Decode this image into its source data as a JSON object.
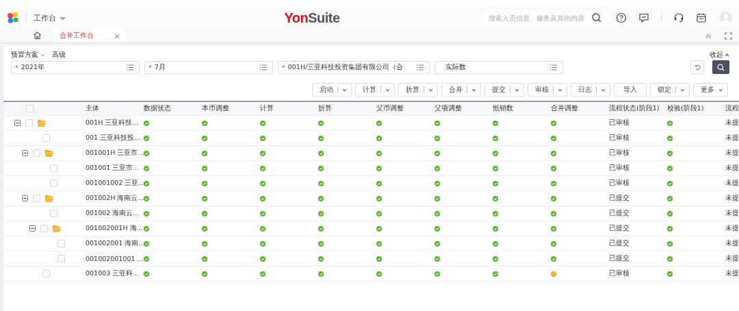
{
  "header": {
    "app_menu": "工作台",
    "logo": [
      "Yon",
      "Suite"
    ],
    "search": {
      "placeholder": "搜索人员信息、服务及其他内容"
    }
  },
  "tabs": [
    {
      "label": "合并工作台",
      "selected": true
    }
  ],
  "filter": {
    "scheme": "预置方案",
    "advanced": "高级",
    "collapse": "收起",
    "fields": [
      {
        "value": "2021年",
        "marker": "*"
      },
      {
        "value": "7月",
        "marker": "*"
      },
      {
        "value": "001H/三亚科技投资集团有限公司（合",
        "marker": "*"
      },
      {
        "value": "实际数"
      }
    ]
  },
  "toolbar": [
    {
      "label": "启动",
      "kind": "split"
    },
    {
      "label": "计算",
      "kind": "split"
    },
    {
      "label": "折算",
      "kind": "split"
    },
    {
      "label": "合并",
      "kind": "split"
    },
    {
      "label": "提交",
      "kind": "split"
    },
    {
      "label": "审核",
      "kind": "split"
    },
    {
      "label": "日志",
      "kind": "split"
    },
    {
      "label": "导入",
      "kind": "plain"
    },
    {
      "label": "锁定",
      "kind": "split"
    },
    {
      "label": "更多",
      "kind": "dropdown"
    }
  ],
  "table": {
    "header_checked": false,
    "columns": [
      "主体",
      "数据状态",
      "本币调整",
      "计算",
      "折算",
      "父币调整",
      "父项调整",
      "抵销数",
      "合并调整",
      "流程状态(阶段1)",
      "校验(阶段1)",
      "流程"
    ],
    "rows": [
      {
        "entity": "001H 三亚科技...",
        "checked": false,
        "expanded": true,
        "statuses": [
          {
            "warning": false
          },
          {
            "warning": false
          },
          {
            "warning": false
          },
          {
            "warning": false
          },
          {
            "warning": false
          },
          {
            "warning": false
          },
          {
            "warning": false
          },
          {
            "warning": false
          }
        ],
        "process": "已审核",
        "check": {
          "warning": false
        },
        "column_12": "未提",
        "children": [
          {
            "entity": "001 三亚科技投...",
            "checked": false,
            "statuses": [
              {
                "warning": false
              },
              {
                "warning": false
              },
              {
                "warning": false
              },
              {
                "warning": false
              },
              {
                "warning": false
              },
              {
                "warning": false
              },
              {
                "warning": false
              },
              {
                "warning": false
              }
            ],
            "process": "已审核",
            "check": {
              "warning": false
            },
            "column_12": "未提"
          },
          {
            "entity": "001001H 三亚市...",
            "checked": false,
            "expanded": true,
            "statuses": [
              {
                "warning": false
              },
              {
                "warning": false
              },
              {
                "warning": false
              },
              {
                "warning": false
              },
              {
                "warning": false
              },
              {
                "warning": false
              },
              {
                "warning": false
              },
              {
                "warning": false
              }
            ],
            "process": "已审核",
            "check": {
              "warning": false
            },
            "column_12": "未提",
            "children": [
              {
                "entity": "001001 三亚市...",
                "checked": false,
                "statuses": [
                  {
                    "warning": false
                  },
                  {
                    "warning": false
                  },
                  {
                    "warning": false
                  },
                  {
                    "warning": false
                  },
                  {
                    "warning": false
                  },
                  {
                    "warning": false
                  },
                  {
                    "warning": false
                  },
                  {
                    "warning": false
                  }
                ],
                "process": "已审核",
                "check": {
                  "warning": false
                },
                "column_12": "未提"
              },
              {
                "entity": "001001002 三亚...",
                "checked": false,
                "statuses": [
                  {
                    "warning": false
                  },
                  {
                    "warning": false
                  },
                  {
                    "warning": false
                  },
                  {
                    "warning": false
                  },
                  {
                    "warning": false
                  },
                  {
                    "warning": false
                  },
                  {
                    "warning": false
                  },
                  {
                    "warning": false
                  }
                ],
                "process": "已审核",
                "check": {
                  "warning": false
                },
                "column_12": "未提"
              }
            ]
          },
          {
            "entity": "001002H 海南云...",
            "checked": false,
            "expanded": true,
            "statuses": [
              {
                "warning": false
              },
              {
                "warning": false
              },
              {
                "warning": false
              },
              {
                "warning": false
              },
              {
                "warning": false
              },
              {
                "warning": false
              },
              {
                "warning": false
              },
              {
                "warning": false
              }
            ],
            "process": "已提交",
            "check": {
              "warning": false
            },
            "column_12": "未提",
            "children": [
              {
                "entity": "001002 海南云...",
                "checked": false,
                "statuses": [
                  {
                    "warning": false
                  },
                  {
                    "warning": false
                  },
                  {
                    "warning": false
                  },
                  {
                    "warning": false
                  },
                  {
                    "warning": false
                  },
                  {
                    "warning": false
                  },
                  {
                    "warning": false
                  },
                  {
                    "warning": false
                  }
                ],
                "process": "已提交",
                "check": {
                  "warning": false
                },
                "column_12": "未提"
              },
              {
                "entity": "001002001H 海...",
                "checked": false,
                "expanded": true,
                "statuses": [
                  {
                    "warning": false
                  },
                  {
                    "warning": false
                  },
                  {
                    "warning": false
                  },
                  {
                    "warning": false
                  },
                  {
                    "warning": false
                  },
                  {
                    "warning": false
                  },
                  {
                    "warning": false
                  },
                  {
                    "warning": false
                  }
                ],
                "process": "已提交",
                "check": {
                  "warning": false
                },
                "column_12": "未提",
                "children": [
                  {
                    "entity": "001002001 海南...",
                    "checked": false,
                    "statuses": [
                      {
                        "warning": false
                      },
                      {
                        "warning": false
                      },
                      {
                        "warning": false
                      },
                      {
                        "warning": false
                      },
                      {
                        "warning": false
                      },
                      {
                        "warning": false
                      },
                      {
                        "warning": false
                      },
                      {
                        "warning": false
                      }
                    ],
                    "process": "已提交",
                    "check": {
                      "warning": false
                    },
                    "column_12": "未提"
                  },
                  {
                    "entity": "001002001001 ...",
                    "checked": false,
                    "statuses": [
                      {
                        "warning": false
                      },
                      {
                        "warning": false
                      },
                      {
                        "warning": false
                      },
                      {
                        "warning": false
                      },
                      {
                        "warning": false
                      },
                      {
                        "warning": false
                      },
                      {
                        "warning": false
                      },
                      {
                        "warning": false
                      }
                    ],
                    "process": "已提交",
                    "check": {
                      "warning": false
                    },
                    "column_12": "未提"
                  }
                ]
              }
            ]
          },
          {
            "entity": "001003 三亚科...",
            "checked": false,
            "statuses": [
              {
                "warning": false
              },
              {
                "warning": false
              },
              {
                "warning": false
              },
              {
                "warning": false
              },
              {
                "warning": false
              },
              {
                "warning": false
              },
              {
                "warning": false
              },
              {
                "warning": true
              }
            ],
            "process": "已审核",
            "check": {
              "warning": false
            },
            "column_12": "未提"
          }
        ]
      }
    ]
  }
}
